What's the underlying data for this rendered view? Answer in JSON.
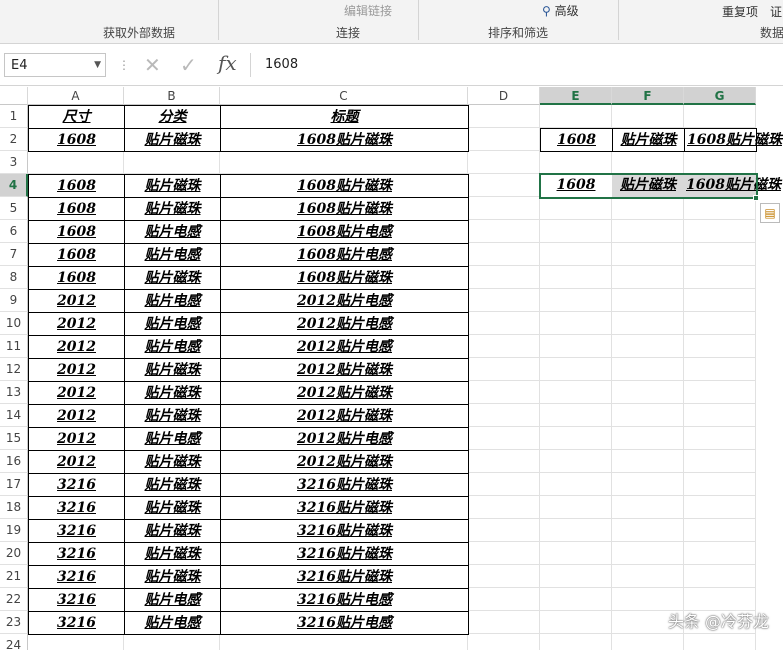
{
  "ribbon": {
    "groups": [
      {
        "label": "获取外部数据"
      },
      {
        "label": "连接"
      },
      {
        "label": "排序和筛选"
      },
      {
        "label": "数据"
      }
    ],
    "edit_links_label": "编辑链接",
    "advanced_label": "高级",
    "repeat_label": "重复项",
    "verify_label": "证"
  },
  "formula_bar": {
    "name_box": "E4",
    "fx_label": "fx",
    "content": "1608"
  },
  "columns": [
    "A",
    "B",
    "C",
    "D",
    "E",
    "F",
    "G"
  ],
  "rows": [
    "1",
    "2",
    "3",
    "4",
    "5",
    "6",
    "7",
    "8",
    "9",
    "10",
    "11",
    "12",
    "13",
    "14",
    "15",
    "16",
    "17",
    "18",
    "19",
    "20",
    "21",
    "22",
    "23",
    "24"
  ],
  "table": {
    "headers": [
      "尺寸",
      "分类",
      "标题"
    ],
    "rows": [
      [
        "1608",
        "贴片磁珠",
        "1608贴片磁珠"
      ],
      null,
      [
        "1608",
        "贴片磁珠",
        "1608贴片磁珠"
      ],
      [
        "1608",
        "贴片磁珠",
        "1608贴片磁珠"
      ],
      [
        "1608",
        "贴片电感",
        "1608贴片电感"
      ],
      [
        "1608",
        "贴片电感",
        "1608贴片电感"
      ],
      [
        "1608",
        "贴片磁珠",
        "1608贴片磁珠"
      ],
      [
        "2012",
        "贴片电感",
        "2012贴片电感"
      ],
      [
        "2012",
        "贴片电感",
        "2012贴片电感"
      ],
      [
        "2012",
        "贴片电感",
        "2012贴片电感"
      ],
      [
        "2012",
        "贴片磁珠",
        "2012贴片磁珠"
      ],
      [
        "2012",
        "贴片磁珠",
        "2012贴片磁珠"
      ],
      [
        "2012",
        "贴片磁珠",
        "2012贴片磁珠"
      ],
      [
        "2012",
        "贴片电感",
        "2012贴片电感"
      ],
      [
        "2012",
        "贴片磁珠",
        "2012贴片磁珠"
      ],
      [
        "3216",
        "贴片磁珠",
        "3216贴片磁珠"
      ],
      [
        "3216",
        "贴片磁珠",
        "3216贴片磁珠"
      ],
      [
        "3216",
        "贴片磁珠",
        "3216贴片磁珠"
      ],
      [
        "3216",
        "贴片磁珠",
        "3216贴片磁珠"
      ],
      [
        "3216",
        "贴片磁珠",
        "3216贴片磁珠"
      ],
      [
        "3216",
        "贴片电感",
        "3216贴片电感"
      ],
      [
        "3216",
        "贴片电感",
        "3216贴片电感"
      ]
    ]
  },
  "side_cells": {
    "E2": "1608",
    "F2": "贴片磁珠",
    "G2": "1608贴片磁珠",
    "E4": "1608",
    "F4": "贴片磁珠",
    "G4": "1608贴片磁珠"
  },
  "active_cell": "E4",
  "colors": {
    "accent": "#217346",
    "header_selected_bg": "#d2d2d2"
  },
  "watermark": "头条 @冷芬龙"
}
